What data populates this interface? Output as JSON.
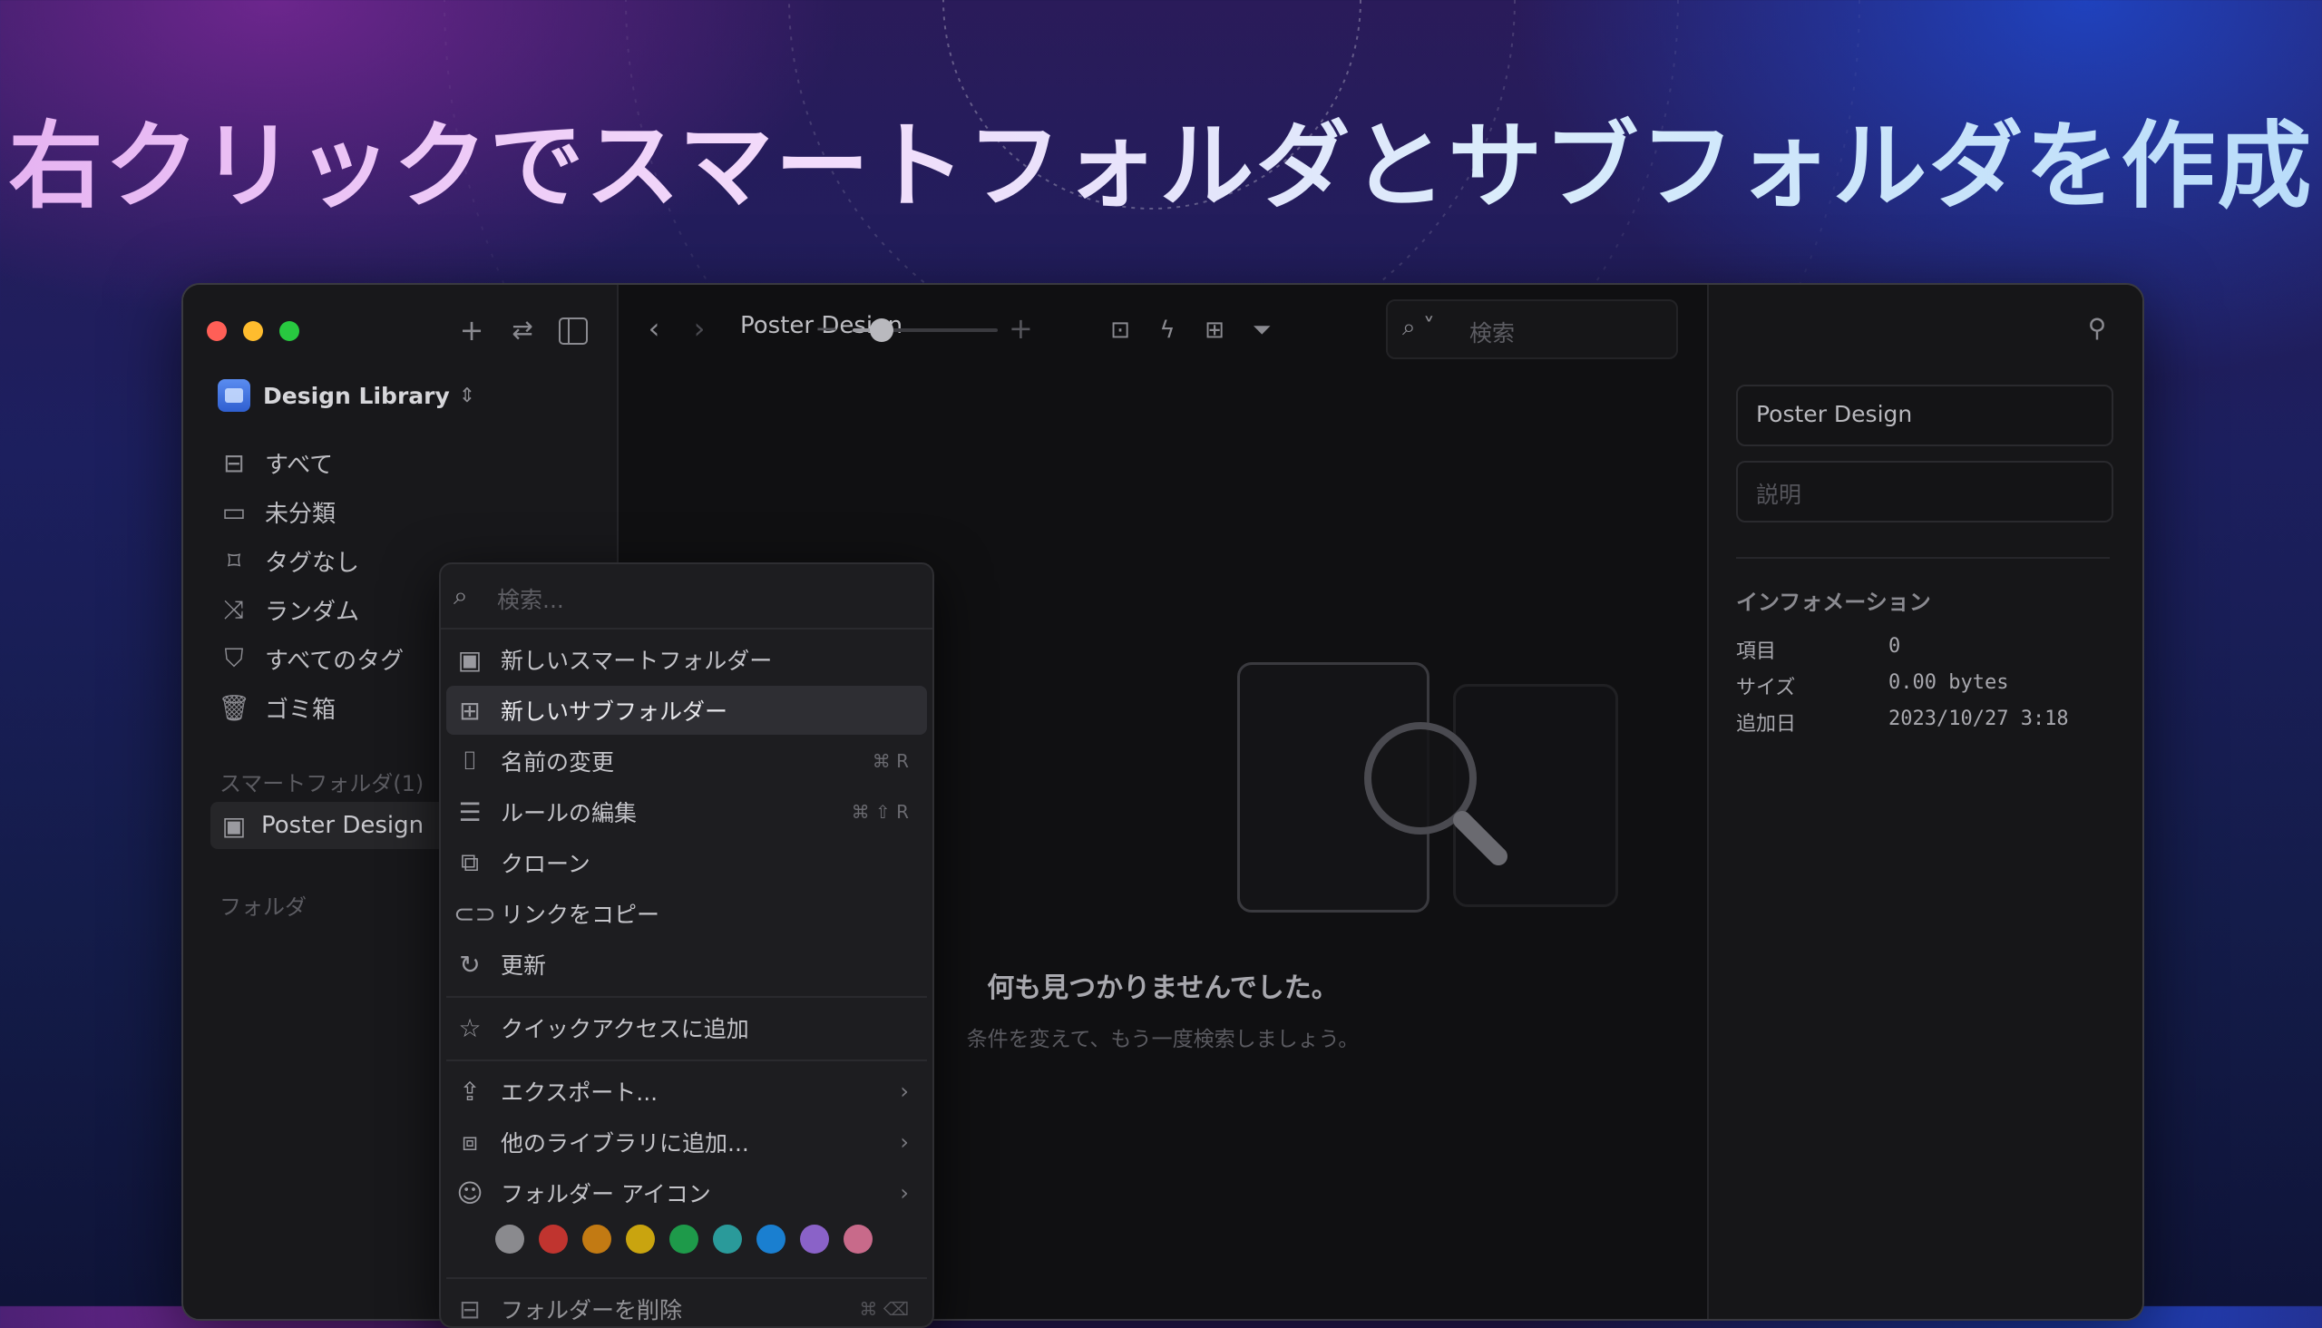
{
  "headline": "右クリックでスマートフォルダとサブフォルダを作成",
  "window": {
    "toolbar": {
      "title": "Poster Design",
      "zoom_level": 0.2,
      "search_placeholder": "検索"
    },
    "sidebar": {
      "library_name": "Design Library",
      "nav": [
        {
          "label": "すべて",
          "icon": "inbox-icon"
        },
        {
          "label": "未分類",
          "icon": "folder-question-icon"
        },
        {
          "label": "タグなし",
          "icon": "tag-off-icon"
        },
        {
          "label": "ランダム",
          "icon": "shuffle-icon"
        },
        {
          "label": "すべてのタグ",
          "icon": "bookmark-icon"
        },
        {
          "label": "ゴミ箱",
          "icon": "trash-icon"
        }
      ],
      "smart_folders_heading": "スマートフォルダ(1)",
      "smart_folder_item": "Poster Design",
      "folders_heading": "フォルダ"
    },
    "main": {
      "empty_title": "何も見つかりませんでした。",
      "empty_subtitle": "条件を変えて、もう一度検索しましょう。"
    },
    "inspector": {
      "name_value": "Poster Design",
      "description_placeholder": "説明",
      "info_heading": "インフォメーション",
      "info": [
        {
          "key": "項目",
          "value": "0"
        },
        {
          "key": "サイズ",
          "value": "0.00 bytes"
        },
        {
          "key": "追加日",
          "value": "2023/10/27 3:18"
        }
      ]
    }
  },
  "context_menu": {
    "search_placeholder": "検索...",
    "items": [
      {
        "label": "新しいスマートフォルダー",
        "icon": "smart-folder-add-icon",
        "shortcut": ""
      },
      {
        "label": "新しいサブフォルダー",
        "icon": "folder-add-icon",
        "shortcut": "",
        "selected": true
      },
      {
        "label": "名前の変更",
        "icon": "rename-icon",
        "shortcut": "⌘ R"
      },
      {
        "label": "ルールの編集",
        "icon": "sliders-icon",
        "shortcut": "⌘ ⇧ R"
      },
      {
        "label": "クローン",
        "icon": "duplicate-icon",
        "shortcut": ""
      },
      {
        "label": "リンクをコピー",
        "icon": "link-icon",
        "shortcut": ""
      },
      {
        "label": "更新",
        "icon": "refresh-icon",
        "shortcut": ""
      },
      {
        "label": "クイックアクセスに追加",
        "icon": "star-icon",
        "shortcut": ""
      },
      {
        "label": "エクスポート...",
        "icon": "export-icon",
        "shortcut": ""
      },
      {
        "label": "他のライブラリに追加...",
        "icon": "library-add-icon",
        "shortcut": ""
      },
      {
        "label": "フォルダー アイコン",
        "icon": "smiley-icon",
        "shortcut": ""
      },
      {
        "label": "フォルダーを削除",
        "icon": "folder-delete-icon",
        "shortcut": "⌘ ⌫"
      }
    ],
    "colors": [
      "#8a8a8e",
      "#c0342f",
      "#c27a13",
      "#c9a40f",
      "#1e9a4a",
      "#2a9a9a",
      "#1a7fd0",
      "#8a62c8",
      "#c86a8a"
    ]
  }
}
